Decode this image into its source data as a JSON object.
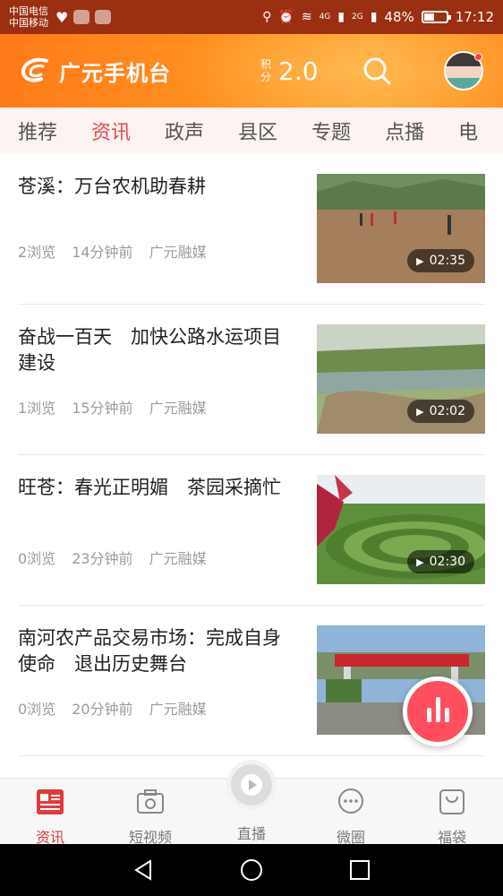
{
  "status_bar": {
    "carrier_1": "中国电信",
    "carrier_2": "中国移动",
    "signal_1": "4G",
    "signal_2": "2G",
    "battery": "48%",
    "battery_level": 0.48,
    "time": "17:12"
  },
  "header": {
    "app_name": "广元手机台",
    "points_label": "积分",
    "points_value": "2.0",
    "brand_color": "#ff8a1f"
  },
  "tabs": [
    {
      "label": "推荐",
      "active": false
    },
    {
      "label": "资讯",
      "active": true
    },
    {
      "label": "政声",
      "active": false
    },
    {
      "label": "县区",
      "active": false
    },
    {
      "label": "专题",
      "active": false
    },
    {
      "label": "点播",
      "active": false
    },
    {
      "label": "电",
      "active": false
    }
  ],
  "news": [
    {
      "title": "苍溪：万台农机助春耕",
      "views": "2浏览",
      "time": "14分钟前",
      "source": "广元融媒",
      "duration": "02:35"
    },
    {
      "title": "奋战一百天　加快公路水运项目建设",
      "views": "1浏览",
      "time": "15分钟前",
      "source": "广元融媒",
      "duration": "02:02"
    },
    {
      "title": "旺苍：春光正明媚　茶园采摘忙",
      "views": "0浏览",
      "time": "23分钟前",
      "source": "广元融媒",
      "duration": "02:30"
    },
    {
      "title": "南河农产品交易市场：完成自身使命　退出历史舞台",
      "views": "0浏览",
      "time": "20分钟前",
      "source": "广元融媒",
      "duration": ""
    }
  ],
  "bottom_nav": [
    {
      "label": "资讯",
      "icon": "news-icon",
      "active": true
    },
    {
      "label": "短视频",
      "icon": "camera-icon",
      "active": false
    },
    {
      "label": "直播",
      "icon": "play-icon",
      "active": false
    },
    {
      "label": "微圈",
      "icon": "chat-icon",
      "active": false
    },
    {
      "label": "福袋",
      "icon": "bag-icon",
      "active": false
    }
  ],
  "accent_color": "#e44a4a"
}
